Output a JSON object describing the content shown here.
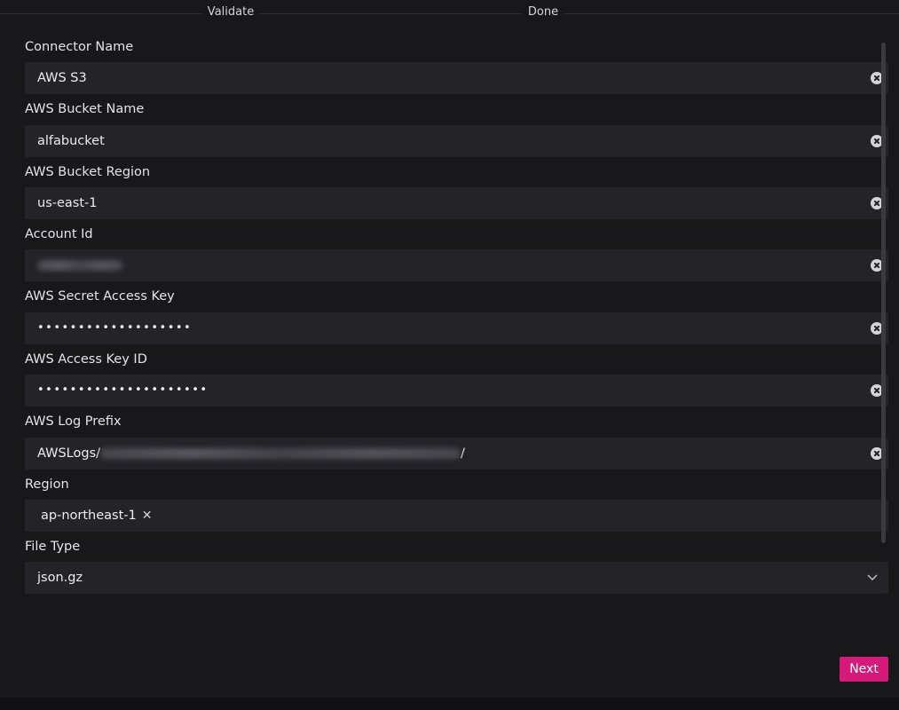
{
  "stepper": {
    "steps": [
      "Validate",
      "Done"
    ]
  },
  "form": {
    "connector_name": {
      "label": "Connector Name",
      "value": "AWS S3"
    },
    "bucket_name": {
      "label": "AWS Bucket Name",
      "value": "alfabucket"
    },
    "bucket_region": {
      "label": "AWS Bucket Region",
      "value": "us-east-1"
    },
    "account_id": {
      "label": "Account Id"
    },
    "secret_key": {
      "label": "AWS Secret Access Key",
      "value": "•••••••••••••••••••"
    },
    "access_key_id": {
      "label": "AWS Access Key ID",
      "value": "•••••••••••••••••••••"
    },
    "log_prefix": {
      "label": "AWS Log Prefix",
      "value_prefix": "AWSLogs/",
      "value_suffix": "/"
    },
    "region": {
      "label": "Region",
      "tags": [
        "ap-northeast-1"
      ],
      "tag_remove": "✕"
    },
    "file_type": {
      "label": "File Type",
      "value": "json.gz"
    }
  },
  "actions": {
    "next_label": "Next"
  },
  "icons": {
    "clear": "clear-icon",
    "chevron": "chevron-down-icon",
    "tag_remove": "close-icon"
  },
  "colors": {
    "background": "#18181b",
    "field_background": "#242428",
    "accent": "#d61a7a"
  }
}
